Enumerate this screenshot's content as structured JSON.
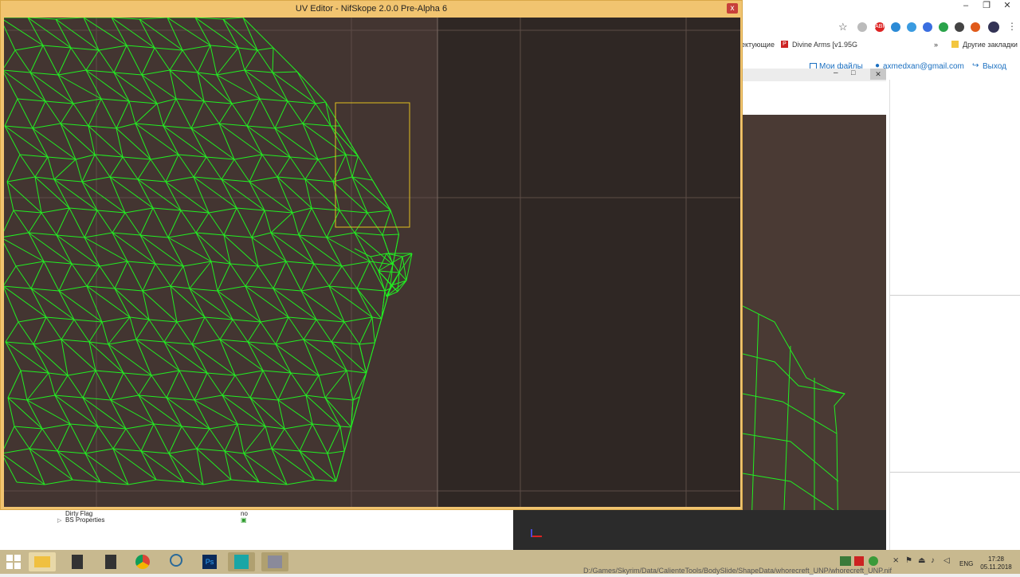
{
  "uv_editor": {
    "title": "UV Editor - NifSkope 2.0.0 Pre-Alpha 6",
    "close_label": "x"
  },
  "browser": {
    "controls": {
      "minimize": "–",
      "restore": "❐",
      "close": "✕"
    },
    "bookmarks": {
      "partial": "ектующие",
      "divine_arms": "Divine Arms [v1.95G",
      "other": "Другие закладки",
      "more": "»"
    },
    "site": {
      "my_files": "Мои файлы",
      "email": "axmedxan@gmail.com",
      "logout": "Выход"
    }
  },
  "nifskope": {
    "properties": [
      {
        "name": "Dirty Flag",
        "value": "no"
      },
      {
        "name": "BS Properties",
        "value": ""
      }
    ]
  },
  "taskbar": {
    "lang": "ENG",
    "time": "17:28",
    "date": "05.11.2018",
    "status_path": "D:/Games/Skyrim/Data/CalienteTools/BodySlide/ShapeData/whorecreft_UNP/whorecreft_UNP.nif"
  },
  "colors": {
    "accent_frame": "#f1c470",
    "mesh": "#22ee22",
    "selection": "#e0c020",
    "texture": "#433531"
  }
}
